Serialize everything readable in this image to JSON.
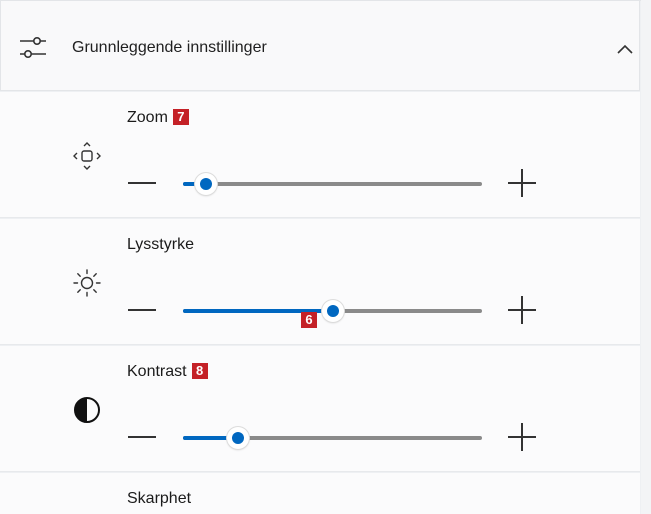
{
  "header": {
    "title": "Grunnleggende innstillinger",
    "icon": "sliders-icon",
    "collapse_icon": "chevron-up-icon"
  },
  "settings": [
    {
      "label": "Zoom",
      "badge": "7",
      "icon": "zoom-pan-icon",
      "value_fraction": 0.04,
      "thumb_badge": ""
    },
    {
      "label": "Lysstyrke",
      "badge": "",
      "icon": "brightness-sun-icon",
      "value_fraction": 0.5,
      "thumb_badge": "6"
    },
    {
      "label": "Kontrast",
      "badge": "8",
      "icon": "contrast-icon",
      "value_fraction": 0.155,
      "thumb_badge": ""
    },
    {
      "label": "Skarphet",
      "badge": "",
      "icon": "",
      "value_fraction": null,
      "thumb_badge": ""
    }
  ],
  "colors": {
    "accent": "#0067c0",
    "badge": "#c42127",
    "track": "#8a8a8a"
  }
}
